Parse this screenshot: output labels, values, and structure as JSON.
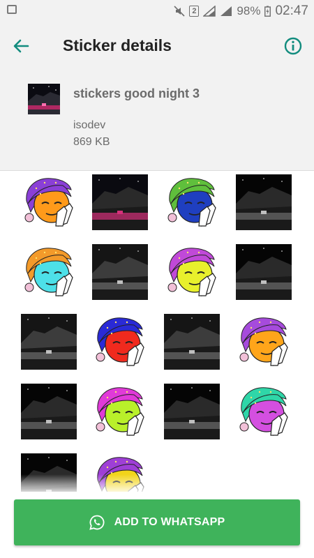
{
  "status_bar": {
    "battery": "98%",
    "time": "02:47",
    "sim_slot": "2"
  },
  "app_bar": {
    "title": "Sticker details"
  },
  "pack": {
    "name": "stickers good night 3",
    "publisher": "isodev",
    "size": "869 KB"
  },
  "stickers": [
    {
      "kind": "emoji",
      "hat": "#8a3fd6",
      "face": "#ff9a1a"
    },
    {
      "kind": "photo",
      "tone": "pink"
    },
    {
      "kind": "emoji",
      "hat": "#5fbf3c",
      "face": "#1f3fc0"
    },
    {
      "kind": "photo",
      "tone": "dark"
    },
    {
      "kind": "emoji",
      "hat": "#f39a2a",
      "face": "#4de0e8"
    },
    {
      "kind": "photo",
      "tone": "gray"
    },
    {
      "kind": "emoji",
      "hat": "#c049d8",
      "face": "#e8f02c"
    },
    {
      "kind": "photo",
      "tone": "dark"
    },
    {
      "kind": "photo",
      "tone": "gray"
    },
    {
      "kind": "emoji",
      "hat": "#2a2ad6",
      "face": "#f02a1e"
    },
    {
      "kind": "photo",
      "tone": "gray"
    },
    {
      "kind": "emoji",
      "hat": "#a64bdc",
      "face": "#ffa51a"
    },
    {
      "kind": "photo",
      "tone": "dark"
    },
    {
      "kind": "emoji",
      "hat": "#e03ad8",
      "face": "#b9f02a"
    },
    {
      "kind": "photo",
      "tone": "dark"
    },
    {
      "kind": "emoji",
      "hat": "#2fd6a8",
      "face": "#d44fe0"
    },
    {
      "kind": "photo",
      "tone": "dark"
    },
    {
      "kind": "emoji",
      "hat": "#9e3fd6",
      "face": "#f2d41a"
    }
  ],
  "button": {
    "label": "ADD TO WHATSAPP"
  },
  "colors": {
    "accent": "#128c7e",
    "button": "#3fb35b",
    "background": "#f2f2f2"
  },
  "icons": {
    "back": "arrow-left-icon",
    "info": "info-icon",
    "whatsapp": "whatsapp-icon"
  }
}
